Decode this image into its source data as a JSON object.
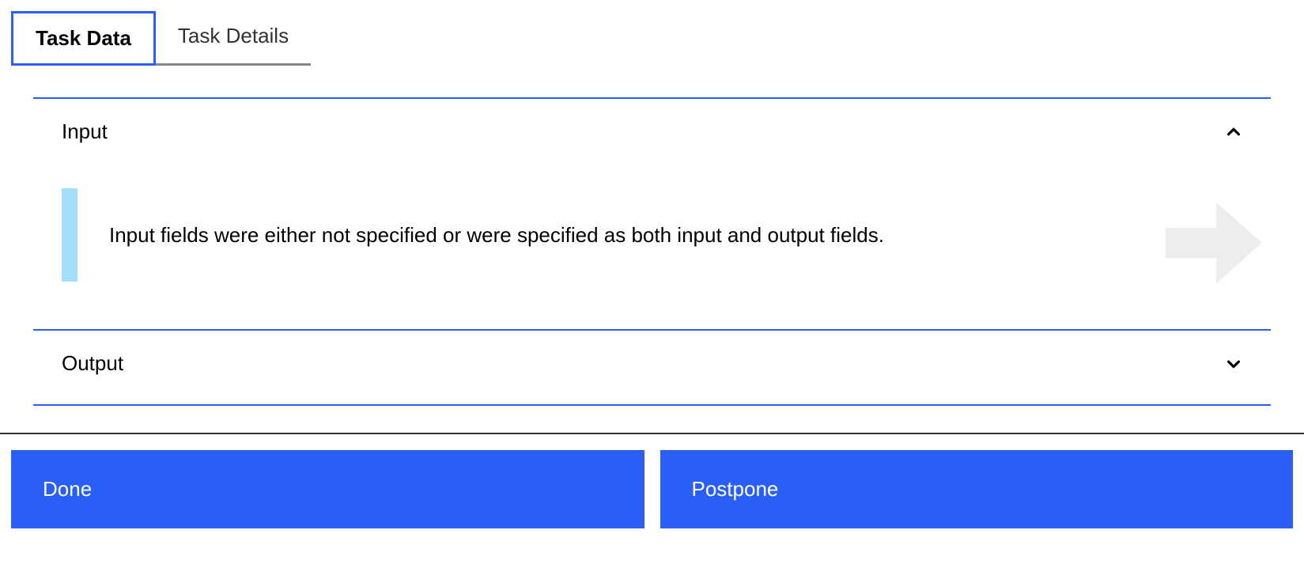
{
  "tabs": {
    "task_data": "Task Data",
    "task_details": "Task Details"
  },
  "sections": {
    "input": {
      "title": "Input",
      "message": "Input fields were either not specified or were specified as both input and output fields."
    },
    "output": {
      "title": "Output"
    }
  },
  "buttons": {
    "done": "Done",
    "postpone": "Postpone"
  }
}
